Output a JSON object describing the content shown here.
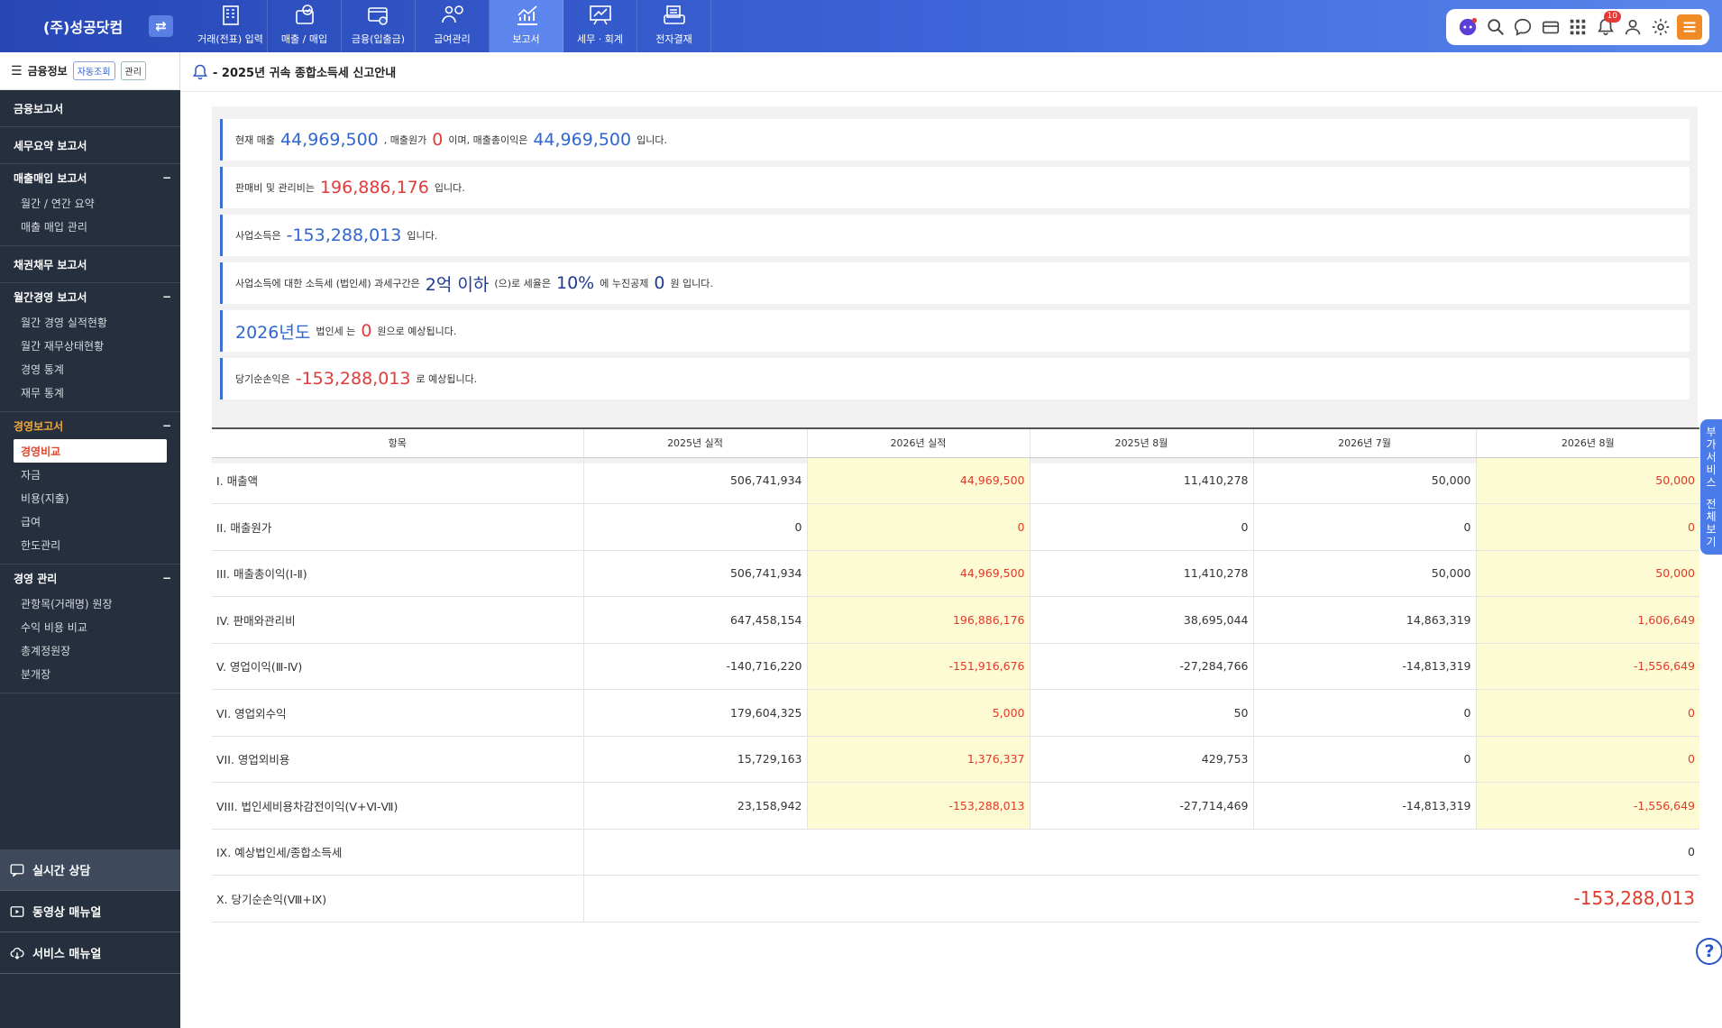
{
  "header": {
    "company": "(주)성공닷컴",
    "swap_icon": "swap-icon",
    "notif_count": "10"
  },
  "nav": [
    {
      "label": "거래(전표) 입력",
      "icon": "building-icon"
    },
    {
      "label": "매출 / 매입",
      "icon": "checklist-icon"
    },
    {
      "label": "금융(입출금)",
      "icon": "card-icon"
    },
    {
      "label": "급여관리",
      "icon": "payroll-icon"
    },
    {
      "label": "보고서",
      "icon": "chart-icon"
    },
    {
      "label": "세무 · 회계",
      "icon": "board-chart-icon"
    },
    {
      "label": "전자결재",
      "icon": "approval-icon"
    }
  ],
  "sidebar": {
    "fin_title": "금융정보",
    "auto_label": "자동조회",
    "manage_label": "관리",
    "sections": [
      {
        "title": "금융보고서",
        "items": []
      },
      {
        "title": "세무요약 보고서",
        "items": []
      },
      {
        "title": "매출매입 보고서",
        "items": [
          "월간 / 연간 요약",
          "매출 매입 관리"
        ]
      },
      {
        "title": "채권채무 보고서",
        "items": []
      },
      {
        "title": "월간경영 보고서",
        "items": [
          "월간 경영 실적현황",
          "월간 재무상태현황",
          "경영 통계",
          "재무 통계"
        ]
      },
      {
        "title": "경영보고서",
        "items": [
          "경영비교",
          "자금",
          "비용(지출)",
          "급여",
          "한도관리"
        ]
      },
      {
        "title": "경영 관리",
        "items": [
          "관항목(거래명) 원장",
          "수익 비용 비교",
          "총계정원장",
          "분개장"
        ]
      }
    ],
    "bottom": [
      "실시간 상담",
      "동영상 매뉴얼",
      "서비스 매뉴얼"
    ]
  },
  "notice": "- 2025년 귀속 종합소득세 신고안내",
  "summary": {
    "r1_a": "현재 매출",
    "r1_v1": "44,969,500",
    "r1_b": ", 매출원가",
    "r1_v2": "0",
    "r1_c": "이며, 매출총이익은",
    "r1_v3": "44,969,500",
    "r1_d": "입니다.",
    "r2_a": "판매비 및 관리비는",
    "r2_v": "196,886,176",
    "r2_b": "입니다.",
    "r3_a": "사업소득은",
    "r3_v": "-153,288,013",
    "r3_b": "입니다.",
    "r4_a": "사업소득에 대한 소득세 (법인세) 과세구간은",
    "r4_v1": "2억 이하",
    "r4_b": "(으)로 세율은",
    "r4_v2": "10%",
    "r4_c": "에 누진공제",
    "r4_v3": "0",
    "r4_d": "원 입니다.",
    "r5_v1": "2026년도",
    "r5_a": "법인세 는",
    "r5_v2": "0",
    "r5_b": "원으로 예상됩니다.",
    "r6_a": "당기순손익은",
    "r6_v": "-153,288,013",
    "r6_b": "로 예상됩니다."
  },
  "table": {
    "headers": [
      "항목",
      "2025년 실적",
      "2026년 실적",
      "2025년 8월",
      "2026년 7월",
      "2026년 8월"
    ],
    "rows": [
      {
        "label": "I. 매출액",
        "vals": [
          "506,741,934",
          "44,969,500",
          "11,410,278",
          "50,000",
          "50,000"
        ]
      },
      {
        "label": "II. 매출원가",
        "vals": [
          "0",
          "0",
          "0",
          "0",
          "0"
        ]
      },
      {
        "label": "III. 매출총이익(Ⅰ-Ⅱ)",
        "vals": [
          "506,741,934",
          "44,969,500",
          "11,410,278",
          "50,000",
          "50,000"
        ]
      },
      {
        "label": "IV. 판매와관리비",
        "vals": [
          "647,458,154",
          "196,886,176",
          "38,695,044",
          "14,863,319",
          "1,606,649"
        ]
      },
      {
        "label": "V. 영업이익(Ⅲ-Ⅳ)",
        "vals": [
          "-140,716,220",
          "-151,916,676",
          "-27,284,766",
          "-14,813,319",
          "-1,556,649"
        ]
      },
      {
        "label": "VI. 영업외수익",
        "vals": [
          "179,604,325",
          "5,000",
          "50",
          "0",
          "0"
        ]
      },
      {
        "label": "VII. 영업외비용",
        "vals": [
          "15,729,163",
          "1,376,337",
          "429,753",
          "0",
          "0"
        ]
      },
      {
        "label": "VIII. 법인세비용차감전이익(Ⅴ+Ⅵ-Ⅶ)",
        "vals": [
          "23,158,942",
          "-153,288,013",
          "-27,714,469",
          "-14,813,319",
          "-1,556,649"
        ]
      }
    ],
    "row9_label": "IX. 예상법인세/종합소득세",
    "row9_value": "0",
    "row10_label": "X. 당기순손익(Ⅷ+Ⅸ)",
    "row10_value": "-153,288,013"
  },
  "side_tab": [
    "부",
    "가",
    "서",
    "비",
    "스",
    "",
    "전",
    "체",
    "보",
    "기"
  ],
  "help": "?"
}
